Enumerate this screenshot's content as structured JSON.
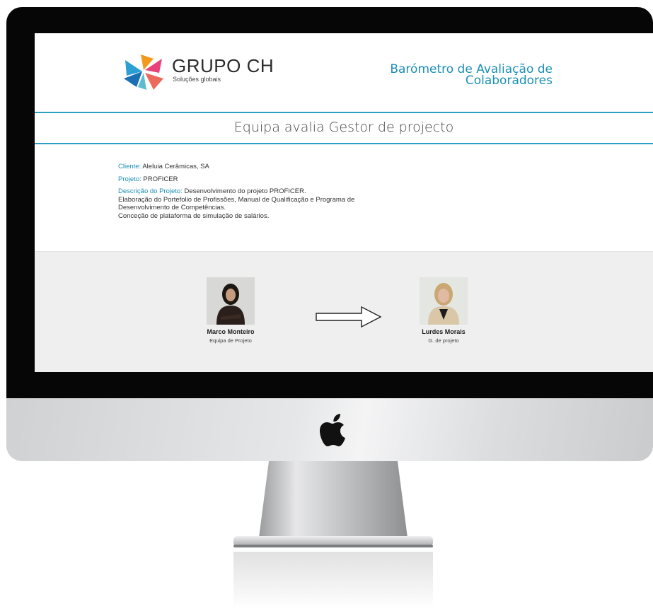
{
  "brand": {
    "name": "GRUPO CH",
    "tagline": "Soluções globais"
  },
  "header": {
    "title_line1": "Barómetro de Avaliação de",
    "title_line2": "Colaboradores"
  },
  "page": {
    "heading": "Equipa avalia Gestor de projecto"
  },
  "project": {
    "client_label": "Cliente:",
    "client_value": " Aleluia Cerâmicas, SA",
    "project_label": "Projeto:",
    "project_value": " PROFICER",
    "description_label": "Descrição do Projeto:",
    "description_line1": " Desenvolvimento do projeto PROFICER.",
    "description_line2": "Elaboração do Portefolio de Profissões, Manual de Qualificação e Programa de",
    "description_line3": "Desenvolvimento de Competências.",
    "description_line4": "Conceção de plataforma de simulação de salários."
  },
  "evaluator": {
    "name": "Marco Monteiro",
    "role": "Equipa de Projeto"
  },
  "evaluated": {
    "name": "Lurdes Morais",
    "role": "G. de projeto"
  },
  "colors": {
    "accent": "#1c8fb6",
    "rule": "#2a9fc4",
    "band": "#efefef"
  },
  "icons": {
    "logo": "grupo-ch-logo-icon",
    "arrow": "right-arrow-icon",
    "device": "apple-logo-icon"
  }
}
